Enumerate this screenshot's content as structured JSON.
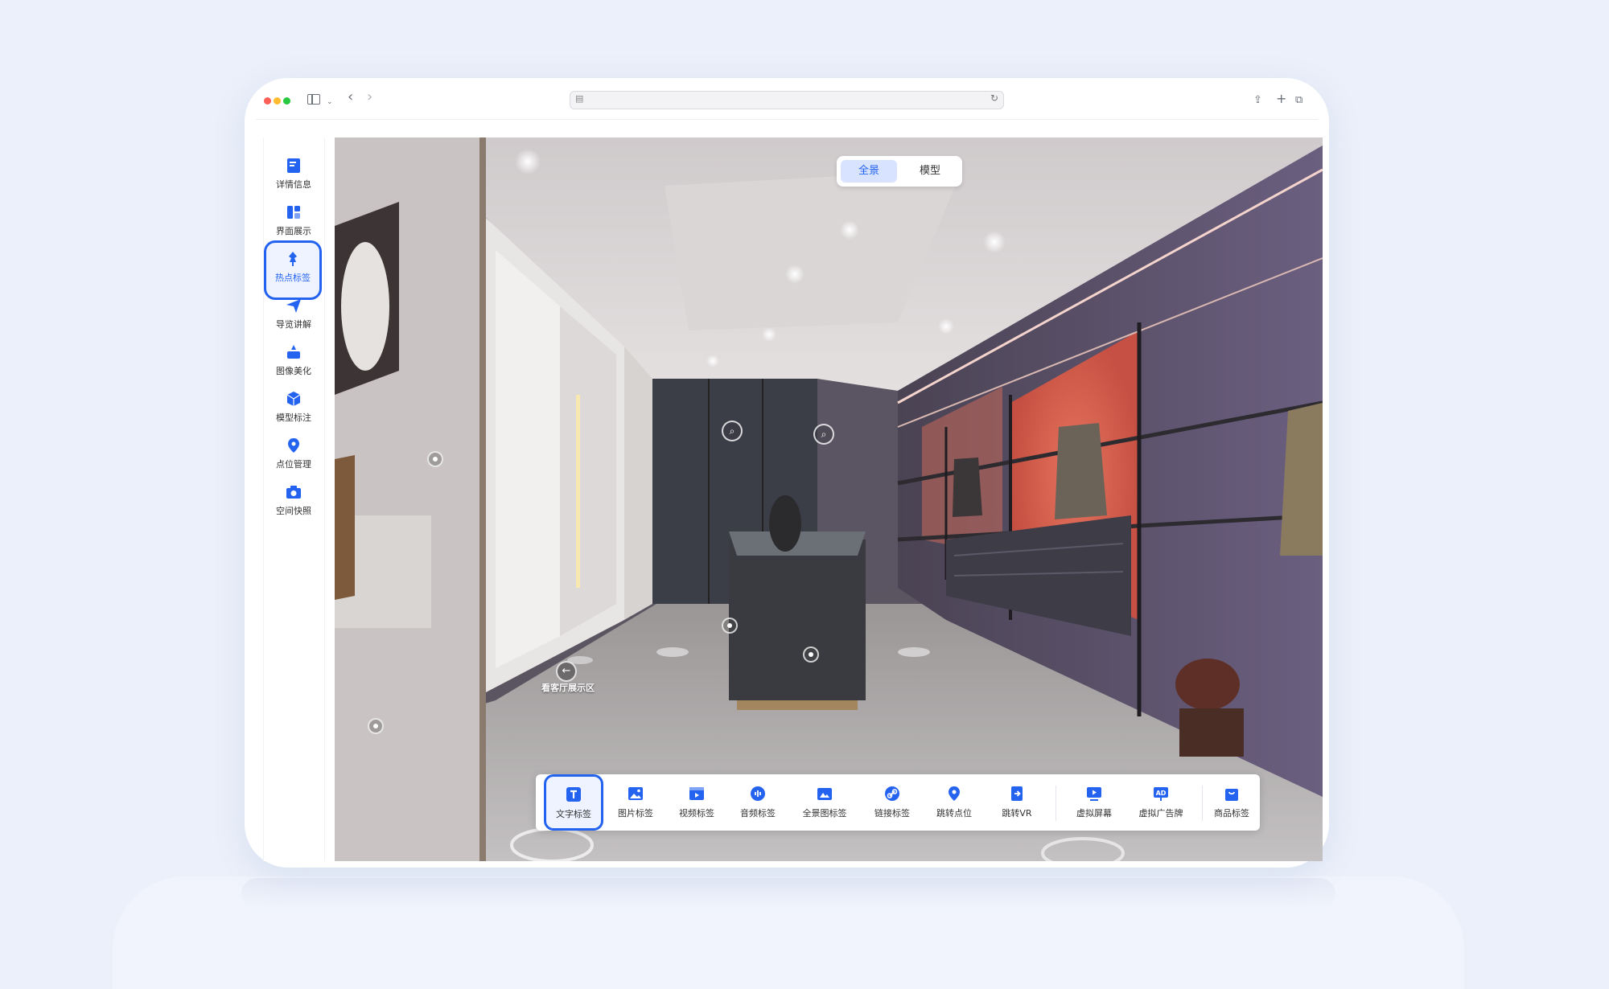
{
  "browser": {
    "url": ""
  },
  "sidebar": {
    "items": [
      {
        "label": "详情信息",
        "icon": "document-icon"
      },
      {
        "label": "界面展示",
        "icon": "layout-icon"
      },
      {
        "label": "热点标签",
        "icon": "pin-icon",
        "active": true
      },
      {
        "label": "导览讲解",
        "icon": "paper-plane-icon"
      },
      {
        "label": "图像美化",
        "icon": "beautify-icon"
      },
      {
        "label": "模型标注",
        "icon": "cube-icon"
      },
      {
        "label": "点位管理",
        "icon": "location-icon"
      },
      {
        "label": "空间快照",
        "icon": "camera-icon"
      }
    ]
  },
  "view_toggle": {
    "options": [
      "全景",
      "模型"
    ],
    "selected": "全景"
  },
  "scene": {
    "nav_label": "看客厅展示区"
  },
  "toolbar": {
    "items": [
      {
        "label": "文字标签",
        "icon": "text-icon",
        "active": true
      },
      {
        "label": "图片标签",
        "icon": "image-icon"
      },
      {
        "label": "视频标签",
        "icon": "video-icon"
      },
      {
        "label": "音频标签",
        "icon": "audio-icon"
      },
      {
        "label": "全景图标签",
        "icon": "panorama-icon"
      },
      {
        "label": "链接标签",
        "icon": "link-icon"
      },
      {
        "label": "跳转点位",
        "icon": "location-icon"
      },
      {
        "label": "跳转VR",
        "icon": "jump-icon"
      },
      {
        "label": "虚拟屏幕",
        "icon": "screen-icon"
      },
      {
        "label": "虚拟广告牌",
        "icon": "ad-icon"
      },
      {
        "label": "商品标签",
        "icon": "bag-icon"
      }
    ]
  },
  "colors": {
    "accent": "#2463f0",
    "background": "#ebf0fa"
  }
}
